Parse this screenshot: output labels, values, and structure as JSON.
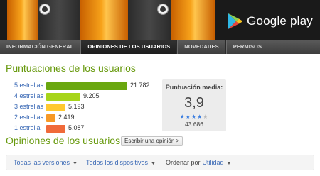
{
  "store": {
    "name": "Google play"
  },
  "tabs": [
    {
      "label": "INFORMACIÓN GENERAL",
      "active": false
    },
    {
      "label": "OPINIONES DE LOS USUARIOS",
      "active": true
    },
    {
      "label": "NOVEDADES",
      "active": false
    },
    {
      "label": "PERMISOS",
      "active": false
    }
  ],
  "ratings": {
    "heading": "Puntuaciones de los usuarios",
    "rows": [
      {
        "label": "5 estrellas",
        "count": "21.782",
        "value": 21782,
        "color": "#6aa70f"
      },
      {
        "label": "4 estrellas",
        "count": "9.205",
        "value": 9205,
        "color": "#a7d51b"
      },
      {
        "label": "3 estrellas",
        "count": "5.193",
        "value": 5193,
        "color": "#ffc930"
      },
      {
        "label": "2 estrellas",
        "count": "2.419",
        "value": 2419,
        "color": "#f79925"
      },
      {
        "label": "1 estrella",
        "count": "5.087",
        "value": 5087,
        "color": "#f06a3a"
      }
    ],
    "average": {
      "title": "Puntuación media:",
      "value": "3,9",
      "stars_filled": 4,
      "stars_total": 5,
      "total": "43.686"
    }
  },
  "reviews": {
    "heading": "Opiniones de los usuarios",
    "write_button": "Escribir una opinión >",
    "filters": {
      "versions": "Todas las versiones",
      "devices": "Todos los dispositivos",
      "sort_label": "Ordenar por",
      "sort_value": "Utilidad"
    }
  },
  "colors": {
    "accent_green": "#689a0e",
    "link_blue": "#3a69b5",
    "star_blue": "#3a7de0"
  }
}
